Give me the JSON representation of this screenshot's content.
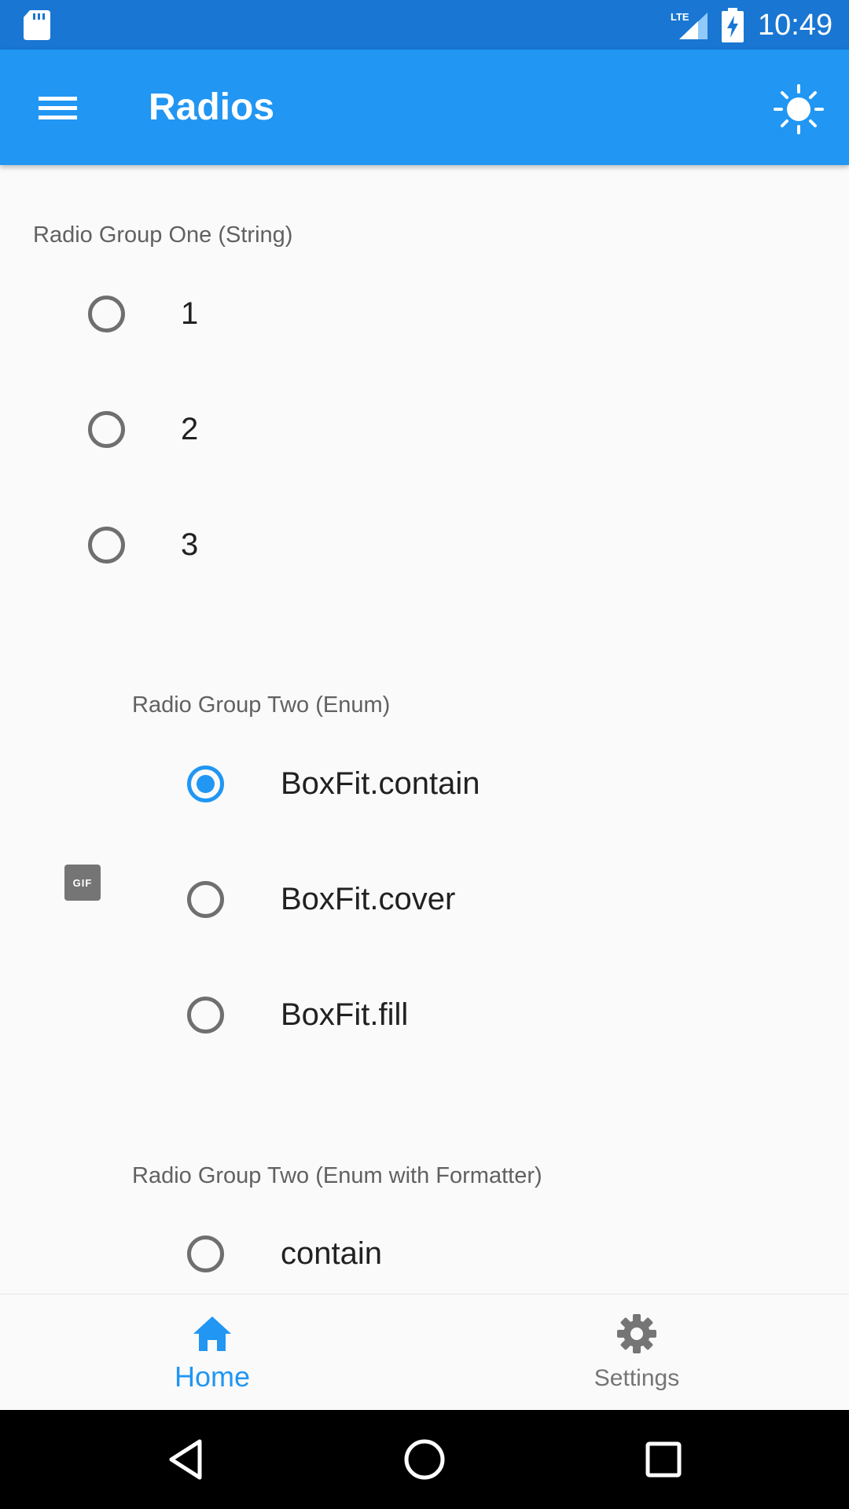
{
  "status_bar": {
    "time": "10:49",
    "network": "LTE"
  },
  "app_bar": {
    "title": "Radios",
    "menu_icon": "menu-icon",
    "theme_icon": "brightness-icon"
  },
  "groups": [
    {
      "label": "Radio Group One (String)",
      "options": [
        "1",
        "2",
        "3"
      ],
      "selected": null
    },
    {
      "label": "Radio Group Two (Enum)",
      "options": [
        "BoxFit.contain",
        "BoxFit.cover",
        "BoxFit.fill"
      ],
      "selected": "BoxFit.contain"
    },
    {
      "label": "Radio Group Two (Enum with Formatter)",
      "options": [
        "contain"
      ],
      "selected": null
    }
  ],
  "gif_badge": "GIF",
  "bottom_nav": {
    "items": [
      {
        "label": "Home",
        "icon": "home-icon",
        "active": true
      },
      {
        "label": "Settings",
        "icon": "settings-icon",
        "active": false
      }
    ]
  },
  "colors": {
    "primary": "#2196f3",
    "primary_dark": "#1976d2",
    "radio_unchecked": "#6f6f6f"
  }
}
